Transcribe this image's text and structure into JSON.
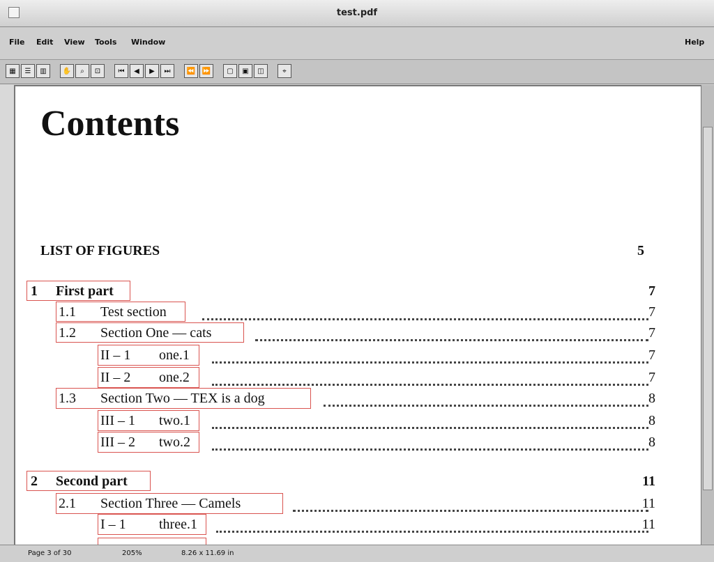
{
  "window": {
    "title": "test.pdf"
  },
  "menu": {
    "file": "File",
    "edit": "Edit",
    "view": "View",
    "tools": "Tools",
    "window": "Window",
    "help": "Help"
  },
  "toolbar": {
    "buttons": [
      "single-page",
      "continuous",
      "facing",
      "hand",
      "zoom-in",
      "zoom-rect",
      "first",
      "prev",
      "next",
      "last",
      "back",
      "forward",
      "fit-page",
      "fit-width",
      "fit-visible",
      "find"
    ]
  },
  "doc": {
    "title": "Contents",
    "lof": "LIST OF FIGURES",
    "lof_page": "5",
    "entries": [
      {
        "num": "1",
        "label": "First part",
        "page": "7"
      },
      {
        "num": "1.1",
        "label": "Test section",
        "page": "7"
      },
      {
        "num": "1.2",
        "label": "Section One — cats",
        "page": "7"
      },
      {
        "num": "II – 1",
        "label": "one.1",
        "page": "7"
      },
      {
        "num": "II – 2",
        "label": "one.2",
        "page": "7"
      },
      {
        "num": "1.3",
        "label": "Section Two — TEX is a dog",
        "page": "8"
      },
      {
        "num": "III – 1",
        "label": "two.1",
        "page": "8"
      },
      {
        "num": "III – 2",
        "label": "two.2",
        "page": "8"
      },
      {
        "num": "2",
        "label": "Second part",
        "page": "11"
      },
      {
        "num": "2.1",
        "label": "Section Three — Camels",
        "page": "11"
      },
      {
        "num": "I – 1",
        "label": "three.1",
        "page": "11"
      }
    ]
  },
  "status": {
    "page": "Page 3 of 30",
    "zoom": "205%",
    "size": "8.26 x 11.69 in"
  }
}
